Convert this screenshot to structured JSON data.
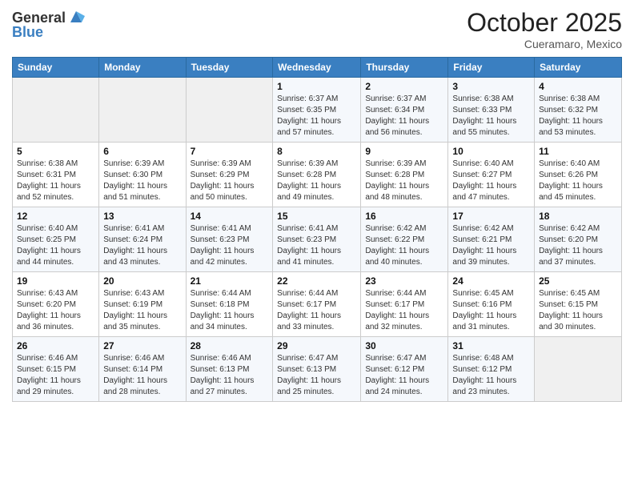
{
  "header": {
    "logo_line1": "General",
    "logo_line2": "Blue",
    "month": "October 2025",
    "location": "Cueramaro, Mexico"
  },
  "days_of_week": [
    "Sunday",
    "Monday",
    "Tuesday",
    "Wednesday",
    "Thursday",
    "Friday",
    "Saturday"
  ],
  "weeks": [
    [
      {
        "day": "",
        "info": ""
      },
      {
        "day": "",
        "info": ""
      },
      {
        "day": "",
        "info": ""
      },
      {
        "day": "1",
        "info": "Sunrise: 6:37 AM\nSunset: 6:35 PM\nDaylight: 11 hours and 57 minutes."
      },
      {
        "day": "2",
        "info": "Sunrise: 6:37 AM\nSunset: 6:34 PM\nDaylight: 11 hours and 56 minutes."
      },
      {
        "day": "3",
        "info": "Sunrise: 6:38 AM\nSunset: 6:33 PM\nDaylight: 11 hours and 55 minutes."
      },
      {
        "day": "4",
        "info": "Sunrise: 6:38 AM\nSunset: 6:32 PM\nDaylight: 11 hours and 53 minutes."
      }
    ],
    [
      {
        "day": "5",
        "info": "Sunrise: 6:38 AM\nSunset: 6:31 PM\nDaylight: 11 hours and 52 minutes."
      },
      {
        "day": "6",
        "info": "Sunrise: 6:39 AM\nSunset: 6:30 PM\nDaylight: 11 hours and 51 minutes."
      },
      {
        "day": "7",
        "info": "Sunrise: 6:39 AM\nSunset: 6:29 PM\nDaylight: 11 hours and 50 minutes."
      },
      {
        "day": "8",
        "info": "Sunrise: 6:39 AM\nSunset: 6:28 PM\nDaylight: 11 hours and 49 minutes."
      },
      {
        "day": "9",
        "info": "Sunrise: 6:39 AM\nSunset: 6:28 PM\nDaylight: 11 hours and 48 minutes."
      },
      {
        "day": "10",
        "info": "Sunrise: 6:40 AM\nSunset: 6:27 PM\nDaylight: 11 hours and 47 minutes."
      },
      {
        "day": "11",
        "info": "Sunrise: 6:40 AM\nSunset: 6:26 PM\nDaylight: 11 hours and 45 minutes."
      }
    ],
    [
      {
        "day": "12",
        "info": "Sunrise: 6:40 AM\nSunset: 6:25 PM\nDaylight: 11 hours and 44 minutes."
      },
      {
        "day": "13",
        "info": "Sunrise: 6:41 AM\nSunset: 6:24 PM\nDaylight: 11 hours and 43 minutes."
      },
      {
        "day": "14",
        "info": "Sunrise: 6:41 AM\nSunset: 6:23 PM\nDaylight: 11 hours and 42 minutes."
      },
      {
        "day": "15",
        "info": "Sunrise: 6:41 AM\nSunset: 6:23 PM\nDaylight: 11 hours and 41 minutes."
      },
      {
        "day": "16",
        "info": "Sunrise: 6:42 AM\nSunset: 6:22 PM\nDaylight: 11 hours and 40 minutes."
      },
      {
        "day": "17",
        "info": "Sunrise: 6:42 AM\nSunset: 6:21 PM\nDaylight: 11 hours and 39 minutes."
      },
      {
        "day": "18",
        "info": "Sunrise: 6:42 AM\nSunset: 6:20 PM\nDaylight: 11 hours and 37 minutes."
      }
    ],
    [
      {
        "day": "19",
        "info": "Sunrise: 6:43 AM\nSunset: 6:20 PM\nDaylight: 11 hours and 36 minutes."
      },
      {
        "day": "20",
        "info": "Sunrise: 6:43 AM\nSunset: 6:19 PM\nDaylight: 11 hours and 35 minutes."
      },
      {
        "day": "21",
        "info": "Sunrise: 6:44 AM\nSunset: 6:18 PM\nDaylight: 11 hours and 34 minutes."
      },
      {
        "day": "22",
        "info": "Sunrise: 6:44 AM\nSunset: 6:17 PM\nDaylight: 11 hours and 33 minutes."
      },
      {
        "day": "23",
        "info": "Sunrise: 6:44 AM\nSunset: 6:17 PM\nDaylight: 11 hours and 32 minutes."
      },
      {
        "day": "24",
        "info": "Sunrise: 6:45 AM\nSunset: 6:16 PM\nDaylight: 11 hours and 31 minutes."
      },
      {
        "day": "25",
        "info": "Sunrise: 6:45 AM\nSunset: 6:15 PM\nDaylight: 11 hours and 30 minutes."
      }
    ],
    [
      {
        "day": "26",
        "info": "Sunrise: 6:46 AM\nSunset: 6:15 PM\nDaylight: 11 hours and 29 minutes."
      },
      {
        "day": "27",
        "info": "Sunrise: 6:46 AM\nSunset: 6:14 PM\nDaylight: 11 hours and 28 minutes."
      },
      {
        "day": "28",
        "info": "Sunrise: 6:46 AM\nSunset: 6:13 PM\nDaylight: 11 hours and 27 minutes."
      },
      {
        "day": "29",
        "info": "Sunrise: 6:47 AM\nSunset: 6:13 PM\nDaylight: 11 hours and 25 minutes."
      },
      {
        "day": "30",
        "info": "Sunrise: 6:47 AM\nSunset: 6:12 PM\nDaylight: 11 hours and 24 minutes."
      },
      {
        "day": "31",
        "info": "Sunrise: 6:48 AM\nSunset: 6:12 PM\nDaylight: 11 hours and 23 minutes."
      },
      {
        "day": "",
        "info": ""
      }
    ]
  ]
}
